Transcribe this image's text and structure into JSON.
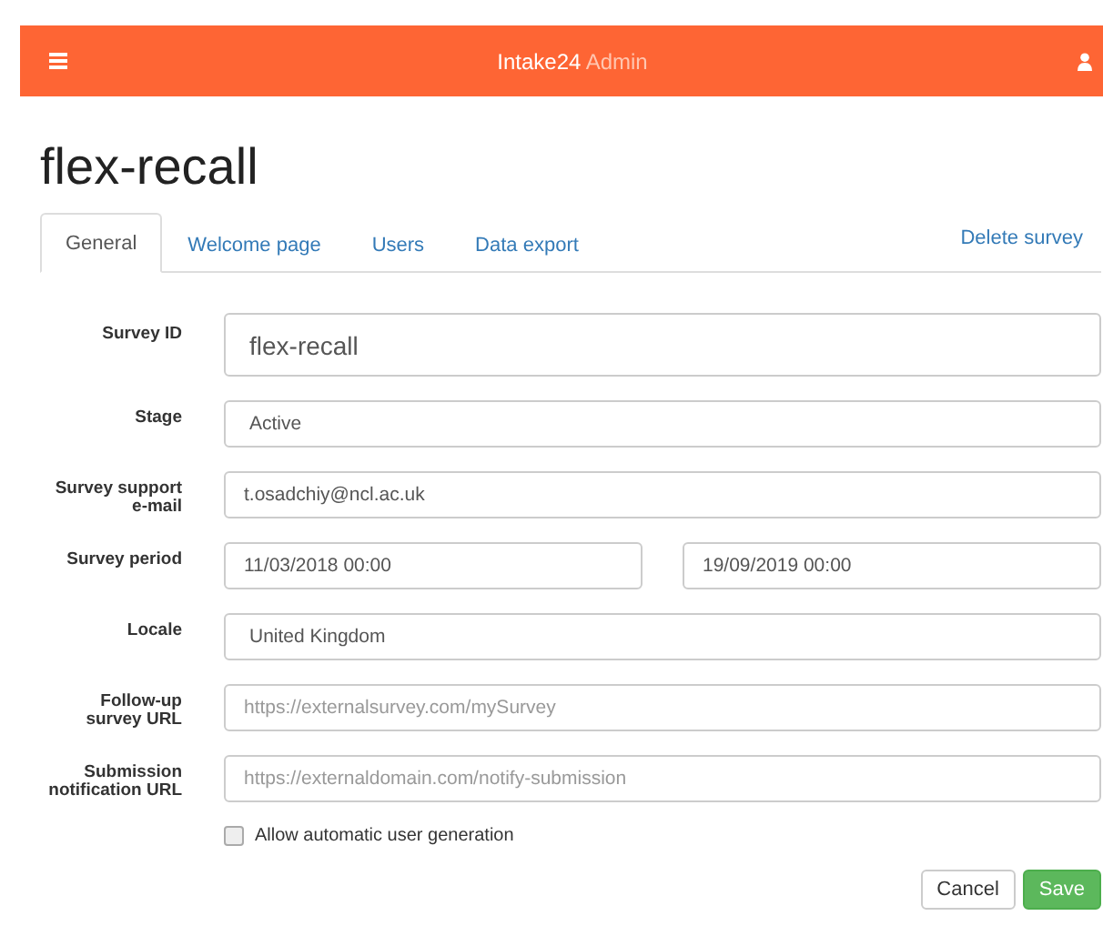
{
  "navbar": {
    "brand": "Intake24",
    "brand_suffix": "Admin"
  },
  "title": "flex-recall",
  "tabs": [
    {
      "label": "General",
      "selected": true
    },
    {
      "label": "Welcome page",
      "selected": false
    },
    {
      "label": "Users",
      "selected": false
    },
    {
      "label": "Data export",
      "selected": false
    }
  ],
  "delete_link": "Delete survey",
  "fields": [
    {
      "kind": "large",
      "label": "Survey ID",
      "value": "flex-recall"
    },
    {
      "kind": "select",
      "label": "Stage",
      "value": "Active"
    },
    {
      "kind": "input",
      "label": "Survey support e-mail",
      "value": "t.osadchiy@ncl.ac.uk"
    },
    {
      "kind": "range",
      "label": "Survey period",
      "value": "11/03/2018 00:00",
      "value2": "19/09/2019 00:00"
    },
    {
      "kind": "select",
      "label": "Locale",
      "value": "United Kingdom"
    },
    {
      "kind": "input",
      "label": "Follow-up survey URL",
      "placeholder": "https://externalsurvey.com/mySurvey"
    },
    {
      "kind": "input",
      "label": "Submission notification URL",
      "placeholder": "https://externaldomain.com/notify-submission"
    }
  ],
  "checkbox": {
    "label": "Allow automatic user generation",
    "checked": false
  },
  "buttons": [
    {
      "label": "Cancel",
      "kind": "default"
    },
    {
      "label": "Save",
      "kind": "primary"
    }
  ]
}
